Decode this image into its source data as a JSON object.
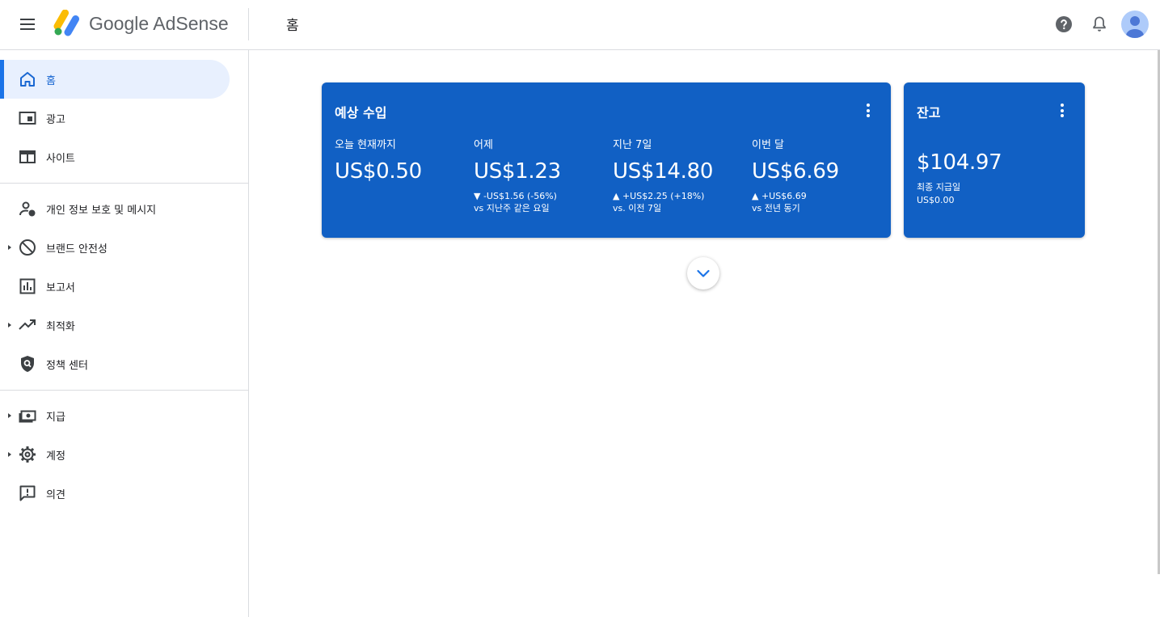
{
  "header": {
    "brand": "Google AdSense",
    "page_title": "홈"
  },
  "sidebar": {
    "items": [
      {
        "label": "홈",
        "icon": "home-icon",
        "active": true
      },
      {
        "label": "광고",
        "icon": "ads-icon"
      },
      {
        "label": "사이트",
        "icon": "sites-icon"
      },
      {
        "label": "개인 정보 보호 및 메시지",
        "icon": "privacy-icon"
      },
      {
        "label": "브랜드 안전성",
        "icon": "block-icon"
      },
      {
        "label": "보고서",
        "icon": "reports-icon"
      },
      {
        "label": "최적화",
        "icon": "trending-icon"
      },
      {
        "label": "정책 센터",
        "icon": "policy-shield-icon"
      },
      {
        "label": "지급",
        "icon": "payments-icon"
      },
      {
        "label": "계정",
        "icon": "settings-gear-icon"
      },
      {
        "label": "의견",
        "icon": "feedback-icon"
      }
    ]
  },
  "earnings": {
    "title": "예상 수입",
    "metrics": [
      {
        "label": "오늘 현재까지",
        "value": "US$0.50",
        "change": "",
        "compare": ""
      },
      {
        "label": "어제",
        "value": "US$1.23",
        "change": "▼ -US$1.56 (-56%)",
        "compare": "vs 지난주 같은 요일"
      },
      {
        "label": "지난 7일",
        "value": "US$14.80",
        "change": "▲ +US$2.25 (+18%)",
        "compare": "vs. 이전 7일"
      },
      {
        "label": "이번 달",
        "value": "US$6.69",
        "change": "▲ +US$6.69",
        "compare": "vs 전년 동기"
      }
    ]
  },
  "balance": {
    "title": "잔고",
    "value": "$104.97",
    "last_payment_label": "최종 지급일",
    "last_payment_value": "US$0.00"
  },
  "colors": {
    "card_blue": "#1160c4",
    "accent": "#1a73e8",
    "active_bg": "#e8f0fe"
  }
}
